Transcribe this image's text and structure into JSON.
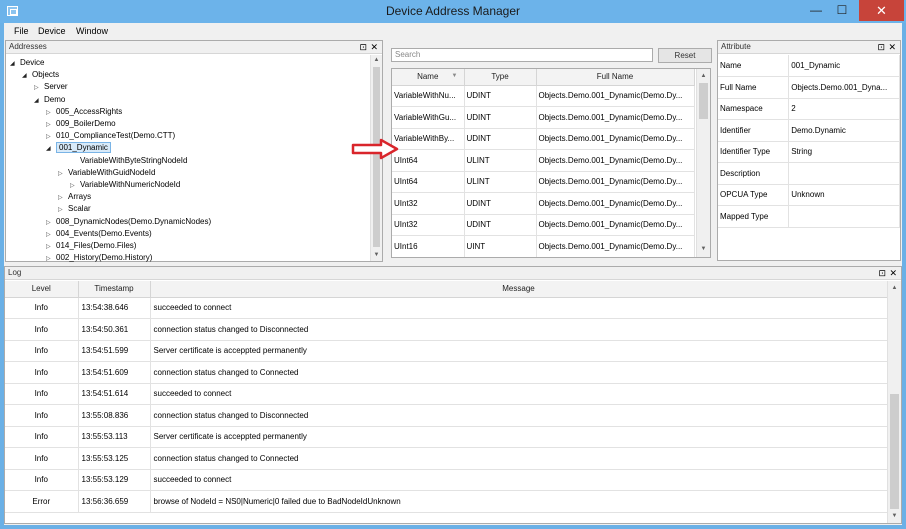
{
  "window": {
    "title": "Device Address Manager",
    "min_glyph": "—",
    "max_glyph": "☐",
    "close_glyph": "✕"
  },
  "menu": [
    "File",
    "Device",
    "Window"
  ],
  "addresses": {
    "title": "Addresses",
    "pin_glyph": "⊡",
    "close_glyph": "✕",
    "tree": [
      {
        "label": "Device",
        "state": "open"
      },
      {
        "label": "Objects",
        "state": "open"
      },
      {
        "label": "Server",
        "state": "closed"
      },
      {
        "label": "Demo",
        "state": "open"
      },
      {
        "label": "005_AccessRights",
        "state": "closed"
      },
      {
        "label": "009_BoilerDemo",
        "state": "closed"
      },
      {
        "label": "010_ComplianceTest(Demo.CTT)",
        "state": "closed"
      },
      {
        "label": "001_Dynamic",
        "state": "open",
        "selected": true
      },
      {
        "label": "VariableWithByteStringNodeId",
        "state": "leaf"
      },
      {
        "label": "VariableWithGuidNodeId",
        "state": "closed"
      },
      {
        "label": "VariableWithNumericNodeId",
        "state": "closed"
      },
      {
        "label": "Arrays",
        "state": "closed"
      },
      {
        "label": "Scalar",
        "state": "closed"
      },
      {
        "label": "008_DynamicNodes(Demo.DynamicNodes)",
        "state": "closed"
      },
      {
        "label": "004_Events(Demo.Events)",
        "state": "closed"
      },
      {
        "label": "014_Files(Demo.Files)",
        "state": "closed"
      },
      {
        "label": "002_History(Demo.History)",
        "state": "closed"
      }
    ]
  },
  "search": {
    "placeholder": "Search",
    "reset_label": "Reset"
  },
  "variables": {
    "columns": [
      "Name",
      "Type",
      "Full Name"
    ],
    "rows": [
      [
        "VariableWithNu...",
        "UDINT",
        "Objects.Demo.001_Dynamic(Demo.Dy..."
      ],
      [
        "VariableWithGu...",
        "UDINT",
        "Objects.Demo.001_Dynamic(Demo.Dy..."
      ],
      [
        "VariableWithBy...",
        "UDINT",
        "Objects.Demo.001_Dynamic(Demo.Dy..."
      ],
      [
        "UInt64",
        "ULINT",
        "Objects.Demo.001_Dynamic(Demo.Dy..."
      ],
      [
        "UInt64",
        "ULINT",
        "Objects.Demo.001_Dynamic(Demo.Dy..."
      ],
      [
        "UInt32",
        "UDINT",
        "Objects.Demo.001_Dynamic(Demo.Dy..."
      ],
      [
        "UInt32",
        "UDINT",
        "Objects.Demo.001_Dynamic(Demo.Dy..."
      ],
      [
        "UInt16",
        "UINT",
        "Objects.Demo.001_Dynamic(Demo.Dy..."
      ]
    ]
  },
  "attribute": {
    "title": "Attribute",
    "pin_glyph": "⊡",
    "close_glyph": "✕",
    "rows": [
      [
        "Name",
        "001_Dynamic"
      ],
      [
        "Full Name",
        "Objects.Demo.001_Dyna..."
      ],
      [
        "Namespace",
        "2"
      ],
      [
        "Identifier",
        "Demo.Dynamic"
      ],
      [
        "Identifier Type",
        "String"
      ],
      [
        "Description",
        ""
      ],
      [
        "OPCUA Type",
        "Unknown"
      ],
      [
        "Mapped Type",
        ""
      ]
    ]
  },
  "log": {
    "title": "Log",
    "pin_glyph": "⊡",
    "close_glyph": "✕",
    "columns": [
      "Level",
      "Timestamp",
      "Message"
    ],
    "rows": [
      [
        "Info",
        "13:54:38.646",
        "succeeded to connect"
      ],
      [
        "Info",
        "13:54:50.361",
        "connection status changed to Disconnected"
      ],
      [
        "Info",
        "13:54:51.599",
        "Server certificate is acceppted permanently"
      ],
      [
        "Info",
        "13:54:51.609",
        "connection status changed to Connected"
      ],
      [
        "Info",
        "13:54:51.614",
        "succeeded to connect"
      ],
      [
        "Info",
        "13:55:08.836",
        "connection status changed to Disconnected"
      ],
      [
        "Info",
        "13:55:53.113",
        "Server certificate is acceppted permanently"
      ],
      [
        "Info",
        "13:55:53.125",
        "connection status changed to Connected"
      ],
      [
        "Info",
        "13:55:53.129",
        "succeeded to connect"
      ],
      [
        "Error",
        "13:56:36.659",
        "browse of NodeId = NS0|Numeric|0 failed due to BadNodeIdUnknown"
      ]
    ]
  },
  "colors": {
    "titlebar": "#6cb3ea",
    "close_button": "#c7443a",
    "selection": "#d8eaf9",
    "arrow": "#d9252b"
  }
}
